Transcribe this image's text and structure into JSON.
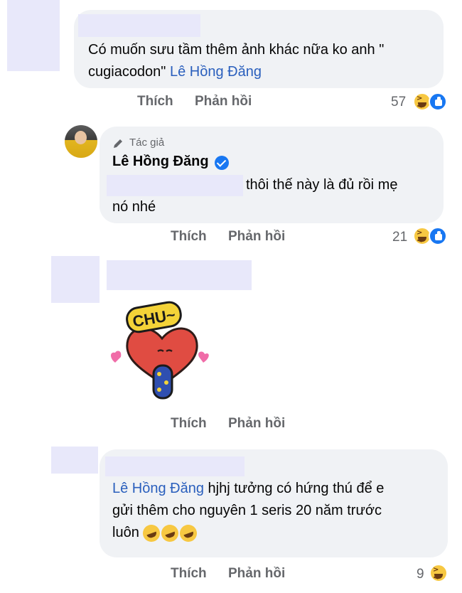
{
  "comments": [
    {
      "text_plain": "Có muốn sưu tầm thêm ảnh khác nữa ko anh \"",
      "text_plain_2": "cugiacodon\"",
      "mention": "Lê Hồng Đăng",
      "actions": {
        "like": "Thích",
        "reply": "Phản hồi"
      },
      "reaction_count": "57"
    },
    {
      "badge": "Tác giả",
      "author": "Lê Hồng Đăng",
      "text_line1": "thôi thế này là đủ rồi mẹ",
      "text_line2": "nó nhé",
      "actions": {
        "like": "Thích",
        "reply": "Phản hồi"
      },
      "reaction_count": "21"
    },
    {
      "sticker_text": "CHU~",
      "actions": {
        "like": "Thích",
        "reply": "Phản hồi"
      }
    },
    {
      "mention": "Lê Hồng Đăng",
      "text_line1": " hjhj tưởng có hứng thú để e",
      "text_line2": "gửi thêm cho nguyên 1 seris 20 năm trước",
      "text_line3": "luôn",
      "actions": {
        "like": "Thích",
        "reply": "Phản hồi"
      },
      "reaction_count": "9"
    }
  ],
  "colors": {
    "link": "#2a5fbd",
    "bubble": "#f0f2f5",
    "muted": "#65676b",
    "redaction": "#e8e8fa"
  },
  "icons": [
    "haha-reaction-icon",
    "like-reaction-icon",
    "pencil-icon",
    "verified-icon",
    "rofl-emoji-icon"
  ]
}
